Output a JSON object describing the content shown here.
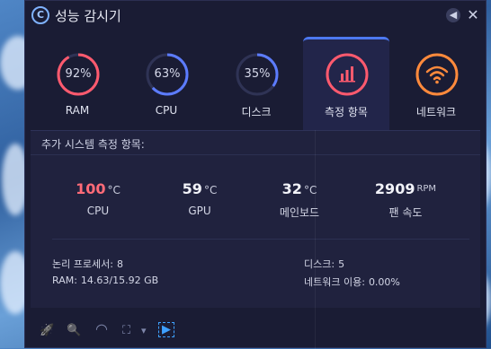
{
  "window": {
    "title": "성능 감시기",
    "logo_letter": "C",
    "back_glyph": "◀",
    "close_glyph": "✕"
  },
  "tabs": [
    {
      "label": "RAM",
      "value": "92%",
      "percent": 92,
      "color": "#ff5a6e"
    },
    {
      "label": "CPU",
      "value": "63%",
      "percent": 63,
      "color": "#5c7cff"
    },
    {
      "label": "디스크",
      "value": "35%",
      "percent": 35,
      "color": "#5c7cff"
    },
    {
      "label": "측정 항목",
      "icon": "bar-chart-icon",
      "color": "#ff5a6e",
      "active": true
    },
    {
      "label": "네트워크",
      "icon": "wifi-icon",
      "color": "#ff8a3c"
    }
  ],
  "panel": {
    "title": "추가 시스템 측정 항목:",
    "metrics": [
      {
        "value": "100",
        "unit": "°C",
        "label": "CPU",
        "hot": true
      },
      {
        "value": "59",
        "unit": "°C",
        "label": "GPU"
      },
      {
        "value": "32",
        "unit": "°C",
        "label": "메인보드"
      },
      {
        "value": "2909",
        "unit": "RPM",
        "label": "팬 속도"
      }
    ],
    "info": {
      "logical_processors_label": "논리 프로세서:",
      "logical_processors_value": "8",
      "ram_label": "RAM:",
      "ram_value": "14.63/15.92 GB",
      "disks_label": "디스크:",
      "disks_value": "5",
      "network_label": "네트워크 이용:",
      "network_value": "0.00%"
    }
  },
  "toolbar": {
    "rocket": "🚀",
    "search": "🔍",
    "gauge": "◠",
    "crop": "⛶",
    "dropdown": "▾",
    "camera": "▶"
  }
}
